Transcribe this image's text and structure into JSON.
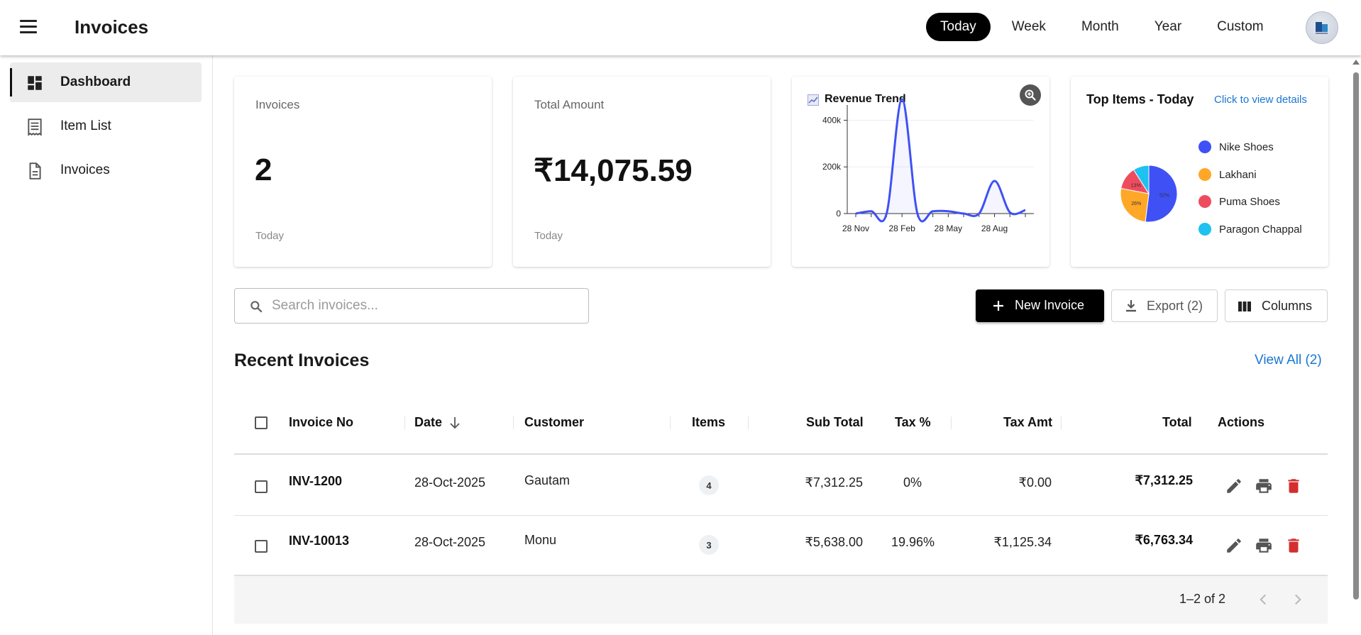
{
  "header": {
    "title": "Invoices",
    "period_tabs": [
      "Today",
      "Week",
      "Month",
      "Year",
      "Custom"
    ],
    "active_period": "Today"
  },
  "sidebar": {
    "items": [
      {
        "label": "Dashboard",
        "icon": "dashboard-icon",
        "active": true
      },
      {
        "label": "Item List",
        "icon": "list-icon",
        "active": false
      },
      {
        "label": "Invoices",
        "icon": "document-icon",
        "active": false
      }
    ]
  },
  "stats": {
    "invoices": {
      "label": "Invoices",
      "value": "2",
      "sub": "Today"
    },
    "total_amount": {
      "label": "Total Amount",
      "value": "₹14,075.59",
      "sub": "Today"
    }
  },
  "revenue_chart": {
    "title": "Revenue Trend",
    "y_ticks": [
      "0",
      "200k",
      "400k"
    ],
    "x_ticks": [
      "28 Nov",
      "28 Feb",
      "28 May",
      "28 Aug"
    ]
  },
  "top_items": {
    "title": "Top Items - Today",
    "link": "Click to view details",
    "legend": [
      {
        "label": "Nike Shoes",
        "color": "#3f51f5"
      },
      {
        "label": "Lakhani",
        "color": "#ffa726"
      },
      {
        "label": "Puma Shoes",
        "color": "#ef4b5e"
      },
      {
        "label": "Paragon Chappal",
        "color": "#1ec1f0"
      }
    ],
    "slice_labels": [
      "52%",
      "26%",
      "13%"
    ]
  },
  "chart_data": [
    {
      "type": "area",
      "title": "Revenue Trend",
      "x": [
        "28 Nov",
        "28 Dec",
        "28 Jan",
        "28 Feb",
        "28 Mar",
        "28 Apr",
        "28 May",
        "28 Jun",
        "28 Jul",
        "28 Aug",
        "28 Sep",
        "28 Oct"
      ],
      "values": [
        0,
        10000,
        0,
        490000,
        0,
        10000,
        10000,
        0,
        0,
        140000,
        5000,
        15000
      ],
      "ylim": [
        0,
        450000
      ],
      "y_ticks": [
        "0",
        "200k",
        "400k"
      ],
      "color": "#3f51f5"
    },
    {
      "type": "pie",
      "title": "Top Items - Today",
      "categories": [
        "Nike Shoes",
        "Lakhani",
        "Puma Shoes",
        "Paragon Chappal"
      ],
      "values": [
        52,
        26,
        13,
        9
      ],
      "labels": [
        "52%",
        "26%",
        "13%",
        ""
      ]
    }
  ],
  "toolbar": {
    "search_placeholder": "Search invoices...",
    "new_invoice": "New Invoice",
    "export": "Export (2)",
    "columns": "Columns"
  },
  "recent": {
    "title": "Recent Invoices",
    "view_all": "View All (2)"
  },
  "table": {
    "headers": [
      "Invoice No",
      "Date",
      "Customer",
      "Items",
      "Sub Total",
      "Tax %",
      "Tax Amt",
      "Total",
      "Actions"
    ],
    "rows": [
      {
        "invoice_no": "INV-1200",
        "date": "28-Oct-2025",
        "customer": "Gautam",
        "items": "4",
        "sub_total": "₹7,312.25",
        "tax_pct": "0%",
        "tax_amt": "₹0.00",
        "total": "₹7,312.25"
      },
      {
        "invoice_no": "INV-10013",
        "date": "28-Oct-2025",
        "customer": "Monu",
        "items": "3",
        "sub_total": "₹5,638.00",
        "tax_pct": "19.96%",
        "tax_amt": "₹1,125.34",
        "total": "₹6,763.34"
      }
    ],
    "pagination": "1–2 of 2"
  }
}
